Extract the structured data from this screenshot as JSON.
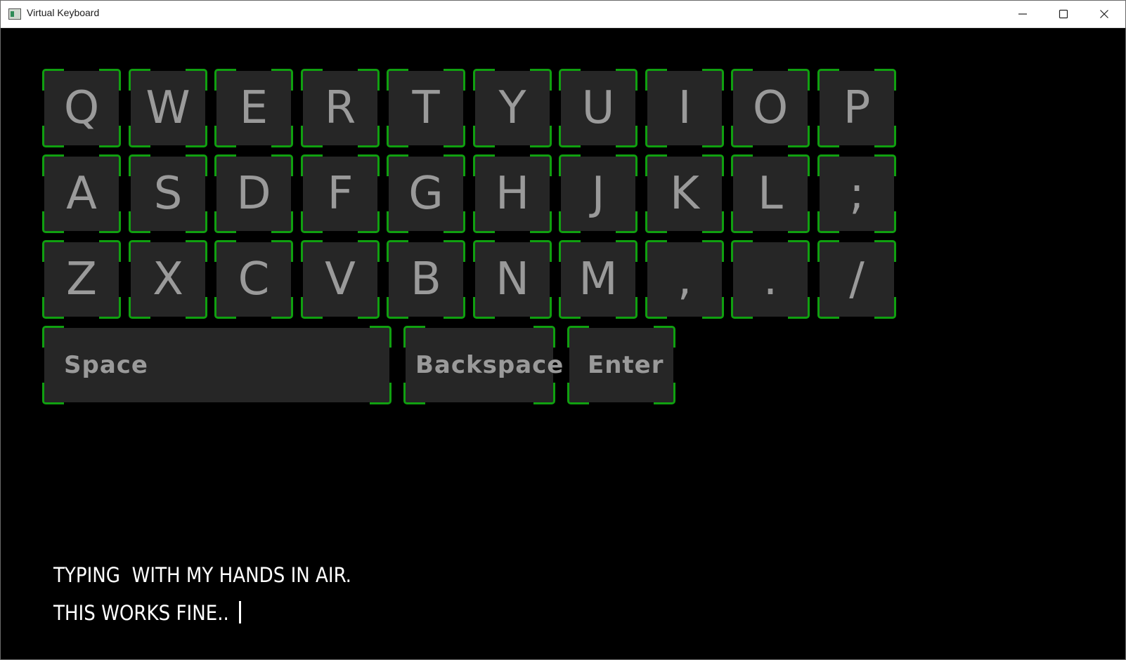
{
  "window": {
    "title": "Virtual Keyboard",
    "controls": [
      "minimize-icon",
      "maximize-icon",
      "close-icon"
    ]
  },
  "keyboard": {
    "rows": [
      [
        "Q",
        "W",
        "E",
        "R",
        "T",
        "Y",
        "U",
        "I",
        "O",
        "P"
      ],
      [
        "A",
        "S",
        "D",
        "F",
        "G",
        "H",
        "J",
        "K",
        "L",
        ";"
      ],
      [
        "Z",
        "X",
        "C",
        "V",
        "B",
        "N",
        "M",
        ",",
        ".",
        "/"
      ]
    ],
    "space_label": "Space",
    "backspace_label": "Backspace",
    "enter_label": "Enter"
  },
  "text_output": {
    "line1": "TYPING  WITH MY HANDS IN AIR.",
    "line2": "THIS WORKS FINE.. "
  },
  "colors": {
    "background": "#000000",
    "key_fill": "#262626",
    "key_text": "#9a9a9a",
    "corner_accent": "#10a010",
    "typed_text": "#ffffff"
  }
}
